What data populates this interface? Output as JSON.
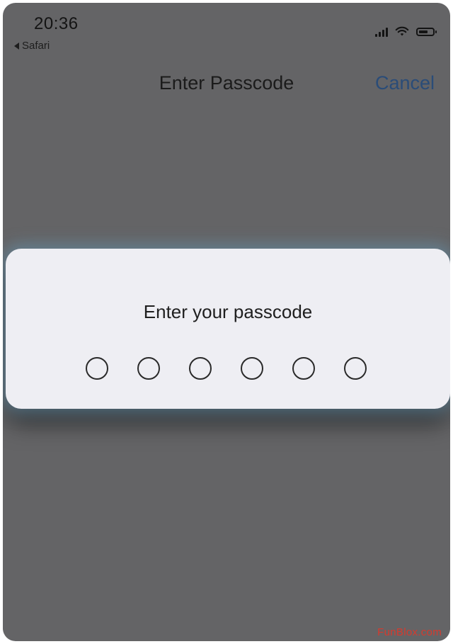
{
  "status_bar": {
    "time": "20:36",
    "back_app": "Safari",
    "icons": [
      "signal-icon",
      "wifi-icon",
      "battery-icon"
    ]
  },
  "nav": {
    "title": "Enter Passcode",
    "cancel_label": "Cancel"
  },
  "dialog": {
    "prompt": "Enter your passcode",
    "passcode_length": 6,
    "digits_entered": 0
  },
  "watermark": "FunBlox.com",
  "colors": {
    "background": "#646466",
    "dialog": "#eeeef3",
    "accent": "#2a4c78",
    "watermark": "#d63a2e"
  }
}
